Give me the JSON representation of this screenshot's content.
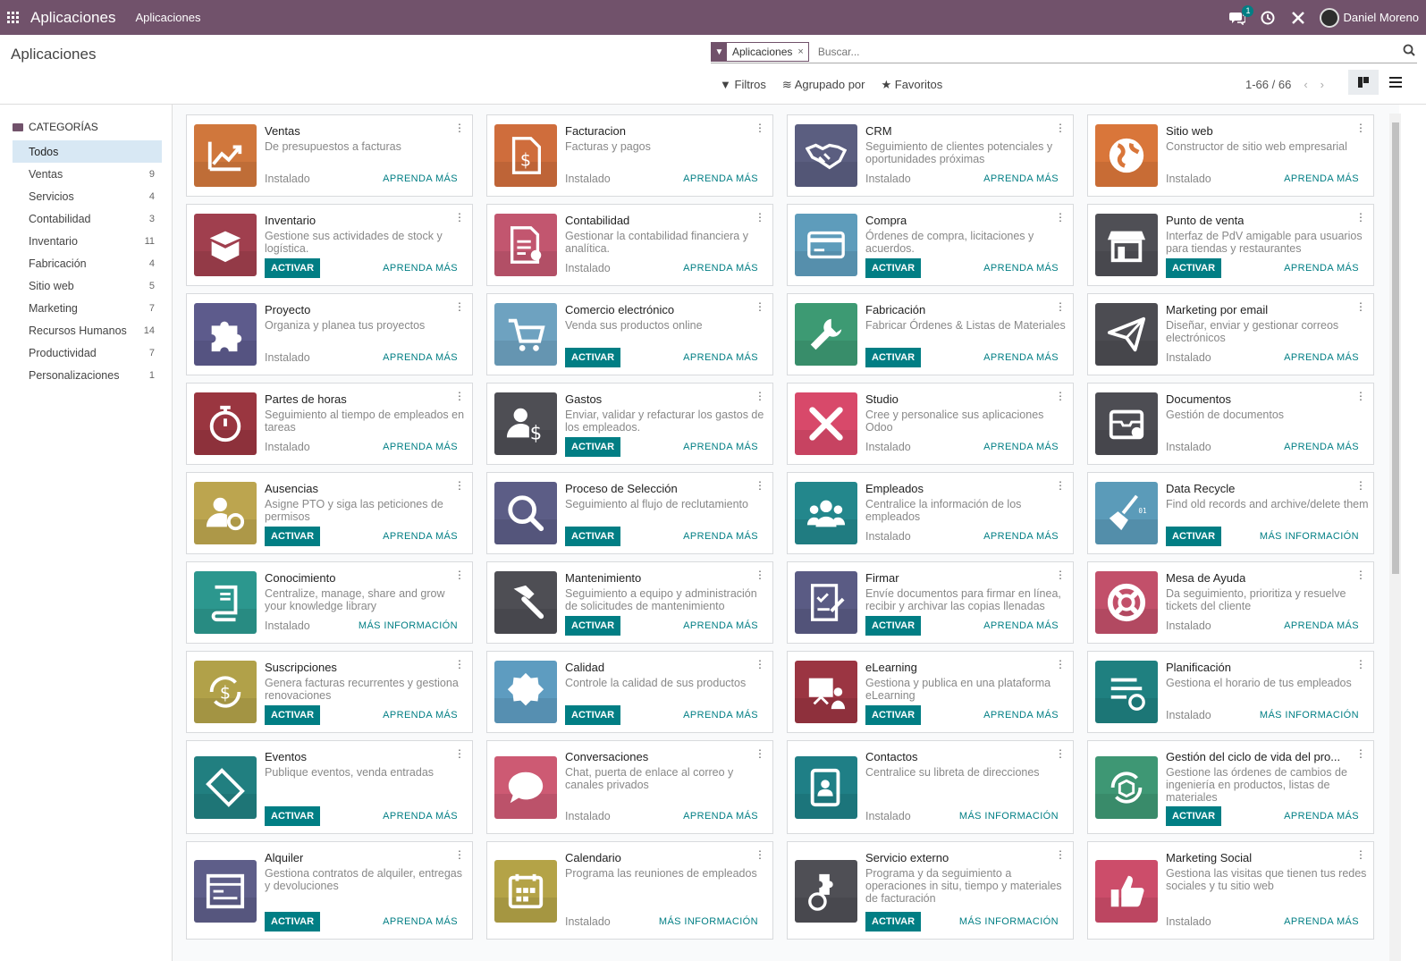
{
  "topbar": {
    "brand": "Aplicaciones",
    "menu": "Aplicaciones",
    "chat_badge": "1",
    "user": "Daniel Moreno"
  },
  "control": {
    "title": "Aplicaciones",
    "facet": "Aplicaciones",
    "search_placeholder": "Buscar...",
    "filters": "Filtros",
    "group_by": "Agrupado por",
    "favorites": "Favoritos",
    "pager": "1-66 / 66"
  },
  "sidebar": {
    "header": "CATEGORÍAS",
    "items": [
      {
        "label": "Todos",
        "count": ""
      },
      {
        "label": "Ventas",
        "count": "9"
      },
      {
        "label": "Servicios",
        "count": "4"
      },
      {
        "label": "Contabilidad",
        "count": "3"
      },
      {
        "label": "Inventario",
        "count": "11"
      },
      {
        "label": "Fabricación",
        "count": "4"
      },
      {
        "label": "Sitio web",
        "count": "5"
      },
      {
        "label": "Marketing",
        "count": "7"
      },
      {
        "label": "Recursos Humanos",
        "count": "14"
      },
      {
        "label": "Productividad",
        "count": "7"
      },
      {
        "label": "Personalizaciones",
        "count": "1"
      }
    ]
  },
  "labels": {
    "installed": "Instalado",
    "activate": "ACTIVAR",
    "learn_more": "APRENDA MÁS",
    "more_info": "MÁS INFORMACIÓN"
  },
  "apps": [
    {
      "name": "Ventas",
      "desc": "De presupuestos a facturas",
      "installed": true,
      "link": "learn",
      "color": "#d0773c",
      "icon": "chart"
    },
    {
      "name": "Facturacion",
      "desc": "Facturas y pagos",
      "installed": true,
      "link": "learn",
      "color": "#cf6d3c",
      "icon": "invoice"
    },
    {
      "name": "CRM",
      "desc": "Seguimiento de clientes potenciales y oportunidades próximas",
      "installed": true,
      "link": "learn",
      "color": "#5b5e80",
      "icon": "handshake"
    },
    {
      "name": "Sitio web",
      "desc": "Constructor de sitio web empresarial",
      "installed": true,
      "link": "learn",
      "color": "#d9763a",
      "icon": "globe"
    },
    {
      "name": "Inventario",
      "desc": "Gestione sus actividades de stock y logística.",
      "installed": false,
      "link": "learn",
      "color": "#a03f4e",
      "icon": "box"
    },
    {
      "name": "Contabilidad",
      "desc": "Gestionar la contabilidad financiera y analítica.",
      "installed": true,
      "link": "learn",
      "color": "#c2566f",
      "icon": "doc"
    },
    {
      "name": "Compra",
      "desc": "Órdenes de compra, licitaciones y acuerdos.",
      "installed": false,
      "link": "learn",
      "color": "#5e9cbb",
      "icon": "card"
    },
    {
      "name": "Punto de venta",
      "desc": "Interfaz de PdV amigable para usuarios para tiendas y restaurantes",
      "installed": false,
      "link": "learn",
      "color": "#4f4f55",
      "icon": "shop"
    },
    {
      "name": "Proyecto",
      "desc": "Organiza y planea tus proyectos",
      "installed": true,
      "link": "learn",
      "color": "#5d5b8c",
      "icon": "puzzle"
    },
    {
      "name": "Comercio electrónico",
      "desc": "Venda sus productos online",
      "installed": false,
      "link": "learn",
      "color": "#6ea2c0",
      "icon": "cart"
    },
    {
      "name": "Fabricación",
      "desc": "Fabricar Órdenes & Listas de Materiales",
      "installed": false,
      "link": "learn",
      "color": "#3d9a73",
      "icon": "wrench"
    },
    {
      "name": "Marketing por email",
      "desc": "Diseñar, enviar y gestionar correos electrónicos",
      "installed": true,
      "link": "learn",
      "color": "#4c4c52",
      "icon": "plane"
    },
    {
      "name": "Partes de horas",
      "desc": "Seguimiento al tiempo de empleados en tareas",
      "installed": true,
      "link": "learn",
      "color": "#9a3640",
      "icon": "timer"
    },
    {
      "name": "Gastos",
      "desc": "Enviar, validar y refacturar los gastos de los empleados.",
      "installed": false,
      "link": "learn",
      "color": "#4e4e54",
      "icon": "expense"
    },
    {
      "name": "Studio",
      "desc": "Cree y personalice sus aplicaciones Odoo",
      "installed": true,
      "link": "learn",
      "color": "#d8496a",
      "icon": "tools"
    },
    {
      "name": "Documentos",
      "desc": "Gestión de documentos",
      "installed": true,
      "link": "learn",
      "color": "#4d4d53",
      "icon": "inbox"
    },
    {
      "name": "Ausencias",
      "desc": "Asigne PTO y siga las peticiones de permisos",
      "installed": false,
      "link": "learn",
      "color": "#bca54f",
      "icon": "usergear"
    },
    {
      "name": "Proceso de Selección",
      "desc": "Seguimiento al flujo de reclutamiento",
      "installed": false,
      "link": "learn",
      "color": "#5c5d86",
      "icon": "search"
    },
    {
      "name": "Empleados",
      "desc": "Centralice la información de los empleados",
      "installed": true,
      "link": "learn",
      "color": "#23878c",
      "icon": "users"
    },
    {
      "name": "Data Recycle",
      "desc": "Find old records and archive/delete them",
      "installed": false,
      "link": "info",
      "color": "#5b9bb9",
      "icon": "broom"
    },
    {
      "name": "Conocimiento",
      "desc": "Centralize, manage, share and grow your knowledge library",
      "installed": true,
      "link": "info",
      "color": "#2c978e",
      "icon": "book"
    },
    {
      "name": "Mantenimiento",
      "desc": "Seguimiento a equipo y administración de solicitudes de mantenimiento",
      "installed": false,
      "link": "learn",
      "color": "#4e4e54",
      "icon": "hammer"
    },
    {
      "name": "Firmar",
      "desc": "Envíe documentos para firmar en línea, recibir y archivar las copias llenadas",
      "installed": false,
      "link": "learn",
      "color": "#5a5b84",
      "icon": "sign"
    },
    {
      "name": "Mesa de Ayuda",
      "desc": "Da seguimiento, prioritiza y resuelve tickets del cliente",
      "installed": true,
      "link": "learn",
      "color": "#c2506a",
      "icon": "lifebuoy"
    },
    {
      "name": "Suscripciones",
      "desc": "Genera facturas recurrentes y gestiona renovaciones",
      "installed": false,
      "link": "learn",
      "color": "#b1a149",
      "icon": "dollarcycle"
    },
    {
      "name": "Calidad",
      "desc": "Controle la calidad de sus productos",
      "installed": false,
      "link": "learn",
      "color": "#5e9cc0",
      "icon": "badge"
    },
    {
      "name": "eLearning",
      "desc": "Gestiona y publica en una plataforma eLearning",
      "installed": false,
      "link": "learn",
      "color": "#9b3542",
      "icon": "board"
    },
    {
      "name": "Planificación",
      "desc": "Gestiona el horario de tus empleados",
      "installed": true,
      "link": "info",
      "color": "#1f8080",
      "icon": "plan"
    },
    {
      "name": "Eventos",
      "desc": "Publique eventos, venda entradas",
      "installed": false,
      "link": "learn",
      "color": "#217f80",
      "icon": "ticket"
    },
    {
      "name": "Conversaciones",
      "desc": "Chat, puerta de enlace al correo y canales privados",
      "installed": true,
      "link": "learn",
      "color": "#cd5a73",
      "icon": "chat"
    },
    {
      "name": "Contactos",
      "desc": "Centralice su libreta de direcciones",
      "installed": true,
      "link": "info",
      "color": "#1f7f86",
      "icon": "contact"
    },
    {
      "name": "Gestión del ciclo de vida del pro...",
      "desc": "Gestione las órdenes de cambios de ingeniería en productos, listas de materiales",
      "installed": false,
      "link": "learn",
      "color": "#3e9774",
      "icon": "cycle"
    },
    {
      "name": "Alquiler",
      "desc": "Gestiona contratos de alquiler, entregas y devoluciones",
      "installed": false,
      "link": "learn",
      "color": "#5e5e89",
      "icon": "calendar"
    },
    {
      "name": "Calendario",
      "desc": "Programa las reuniones de empleados",
      "installed": true,
      "link": "info",
      "color": "#b4a347",
      "icon": "calgrid"
    },
    {
      "name": "Servicio externo",
      "desc": "Programa y da seguimiento a operaciones in situ, tiempo y materiales de facturación",
      "installed": false,
      "link": "info",
      "color": "#4f4f55",
      "icon": "fieldsvc"
    },
    {
      "name": "Marketing Social",
      "desc": "Gestiona las visitas que tienen tus redes sociales y tu sitio web",
      "installed": true,
      "link": "learn",
      "color": "#cc4d6a",
      "icon": "thumb"
    }
  ]
}
